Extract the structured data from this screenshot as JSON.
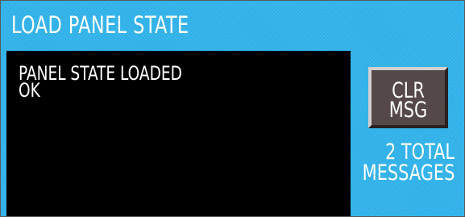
{
  "window": {
    "title": "LOAD PANEL STATE"
  },
  "messages": {
    "lines": [
      "PANEL STATE LOADED",
      "OK"
    ]
  },
  "clear_button": {
    "line1": "CLR",
    "line2": "MSG"
  },
  "message_count": {
    "line1": "2  TOTAL",
    "line2": "MESSAGES"
  },
  "colors": {
    "panel_background": "#31b4ec",
    "message_background": "#000000",
    "button_face": "#544848",
    "text": "#ffffff"
  }
}
